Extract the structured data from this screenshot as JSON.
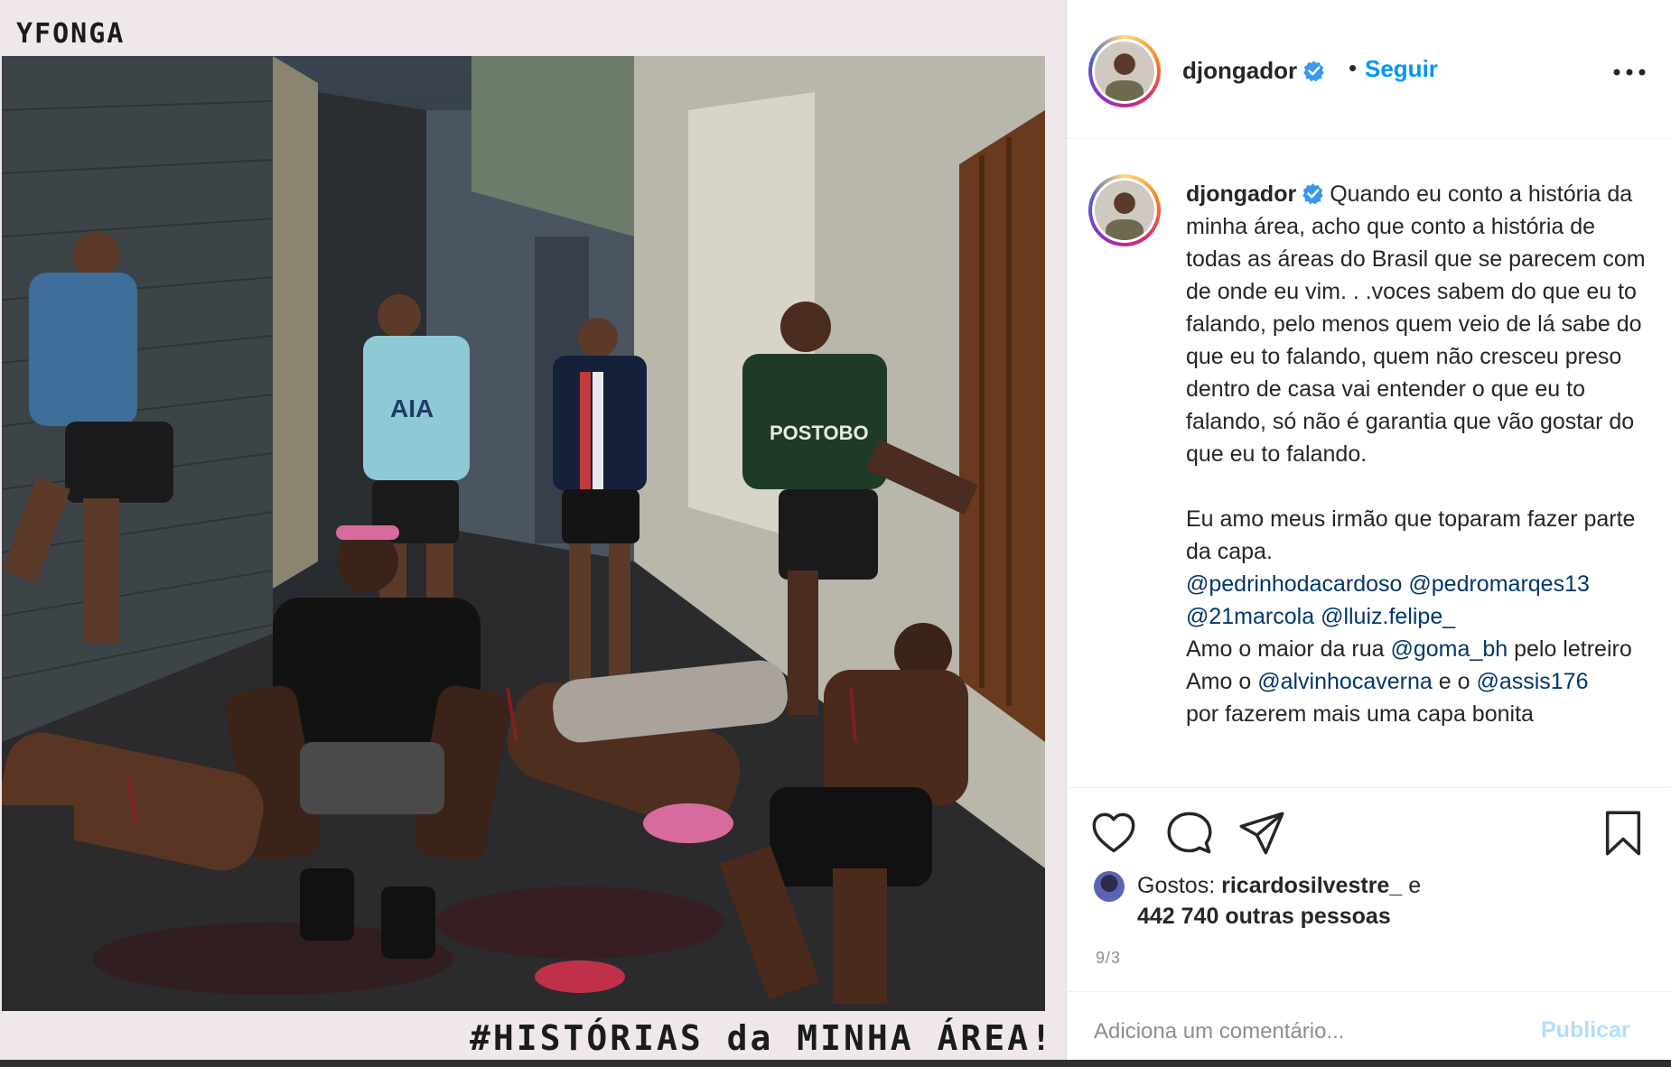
{
  "post": {
    "album_tag": "YFONGA",
    "album_title": "#HISTÓRIAS da MINHA ÁREA!",
    "image_alt": "Group of young men in a narrow alley, several lying on the ground"
  },
  "header": {
    "username": "djongador",
    "verified": true,
    "separator": "•",
    "follow_label": "Seguir",
    "more_label": "..."
  },
  "caption": {
    "username": "djongador",
    "text_1": "Quando eu conto a história da minha área, acho que conto a história de todas as áreas do Brasil que se parecem com de onde eu vim. . .voces sabem do que eu to falando, pelo menos quem veio de lá sabe do que eu to falando, quem não cresceu preso dentro de casa vai entender o que eu to falando, só não é garantia que vão gostar do que eu to falando.",
    "text_2": "Eu amo meus irmão que toparam fazer parte da capa.",
    "mentions_1": [
      "@pedrinhodacardoso",
      "@pedromarqes13",
      "@21marcola",
      "@lluiz.felipe_"
    ],
    "text_3a": "Amo o maior da rua",
    "mention_goma": "@goma_bh",
    "text_3b": "pelo letreiro",
    "text_4a": "Amo o",
    "mention_alvinho": "@alvinhocaverna",
    "text_4b": "e o",
    "mention_assis": "@assis176",
    "text_5": "por fazerem mais uma capa bonita"
  },
  "actions": {
    "like_icon": "heart-icon",
    "comment_icon": "comment-icon",
    "share_icon": "paper-plane-icon",
    "save_icon": "bookmark-icon"
  },
  "likes": {
    "prefix": "Gostos:",
    "user": "ricardosilvestre_",
    "conj": "e",
    "others": "442 740 outras pessoas"
  },
  "date": "9/3",
  "comment": {
    "placeholder": "Adiciona um comentário...",
    "publish_label": "Publicar"
  },
  "colors": {
    "accent": "#0095f6",
    "mention": "#00376b",
    "publish_disabled": "#b2dffc",
    "muted": "#8e8e8e"
  }
}
